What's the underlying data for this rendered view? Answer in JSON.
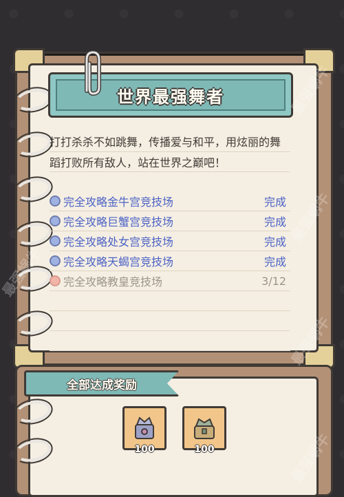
{
  "title": "世界最强舞者",
  "description": "打打杀杀不如跳舞，传播爱与和平，用炫丽的舞蹈打败所有敌人，站在世界之巅吧！",
  "tasks": [
    {
      "label": "完全攻略金牛宫竞技场",
      "status": "完成",
      "done": true
    },
    {
      "label": "完全攻略巨蟹宫竞技场",
      "status": "完成",
      "done": true
    },
    {
      "label": "完全攻略处女宫竞技场",
      "status": "完成",
      "done": true
    },
    {
      "label": "完全攻略天蝎宫竞技场",
      "status": "完成",
      "done": true
    },
    {
      "label": "完全攻略教皇竞技场",
      "status": "3/12",
      "done": false
    }
  ],
  "reward_header": "全部达成奖励",
  "rewards": [
    {
      "icon": "armor-chest-icon",
      "qty": "100"
    },
    {
      "icon": "treasure-chest-icon",
      "qty": "100"
    }
  ],
  "watermarks": [
    "最强蜗牛",
    "最强蜗牛",
    "最强蜗牛",
    "最强蜗牛",
    "最强蜗牛"
  ],
  "colors": {
    "task_done": "#4c62c5",
    "task_pending": "#9c948a",
    "banner": "#7fb9b6"
  }
}
